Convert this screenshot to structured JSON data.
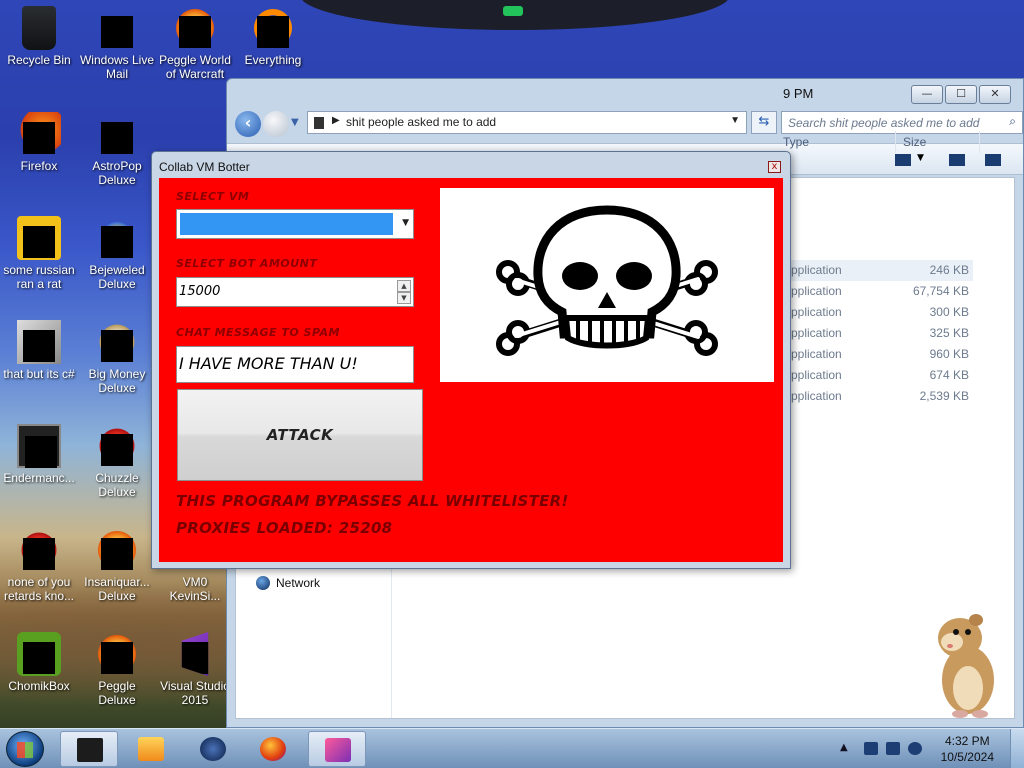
{
  "desktop": {
    "icons": [
      {
        "label": "Recycle Bin",
        "icon": "recycle-bin-icon"
      },
      {
        "label": "Windows Live Mail",
        "icon": "mail-icon"
      },
      {
        "label": "Peggle World of Warcraft",
        "icon": "peggle-icon"
      },
      {
        "label": "Everything",
        "icon": "everything-icon"
      },
      {
        "label": "Firefox",
        "icon": "firefox-icon"
      },
      {
        "label": "AstroPop Deluxe",
        "icon": "astropop-icon"
      },
      {
        "label": "some russian ran a rat",
        "icon": "file-icon"
      },
      {
        "label": "Bejeweled Deluxe",
        "icon": "bejeweled-icon"
      },
      {
        "label": "that but its c#",
        "icon": "stack-icon"
      },
      {
        "label": "Big Money Deluxe",
        "icon": "money-icon"
      },
      {
        "label": "Endermanc...",
        "icon": "app-icon"
      },
      {
        "label": "Chuzzle Deluxe",
        "icon": "chuzzle-icon"
      },
      {
        "label": "none of you retards kno...",
        "icon": "app-icon"
      },
      {
        "label": "Insaniquar... Deluxe",
        "icon": "insaniquarium-icon"
      },
      {
        "label": "VM0 KevinSi...",
        "icon": "app-icon"
      },
      {
        "label": "ChomikBox",
        "icon": "chomikbox-icon"
      },
      {
        "label": "Peggle Deluxe",
        "icon": "peggle-icon"
      },
      {
        "label": "Visual Studio 2015",
        "icon": "visual-studio-icon"
      }
    ]
  },
  "explorer": {
    "address": "shit people asked me to add",
    "search_placeholder": "Search shit people asked me to add",
    "clipped_date": "9 PM",
    "columns": {
      "type": "Type",
      "size": "Size"
    },
    "files": [
      {
        "type": "Application",
        "size": "246 KB"
      },
      {
        "type": "Application",
        "size": "67,754 KB"
      },
      {
        "type": "Application",
        "size": "300 KB"
      },
      {
        "type": "Application",
        "size": "325 KB"
      },
      {
        "type": "Application",
        "size": "960 KB"
      },
      {
        "type": "Application",
        "size": "674 KB"
      },
      {
        "type": "Application",
        "size": "2,539 KB"
      }
    ],
    "nav_network": "Network",
    "buttons": {
      "minimize": "—",
      "maximize": "☐",
      "close": "✕"
    }
  },
  "botter": {
    "title": "Collab VM Botter",
    "close_label": "x",
    "select_vm_label": "SELECT VM",
    "bot_amount_label": "SELECT BOT AMOUNT",
    "bot_amount_value": "15000",
    "chat_label": "CHAT MESSAGE TO SPAM",
    "chat_value": "I HAVE MORE THAN U!",
    "attack_label": "ATTACK",
    "bypass_text": "THIS PROGRAM BYPASSES ALL WHITELISTER!",
    "proxies_text": "PROXIES LOADED: 25208"
  },
  "taskbar": {
    "time": "4:32 PM",
    "date": "10/5/2024"
  }
}
